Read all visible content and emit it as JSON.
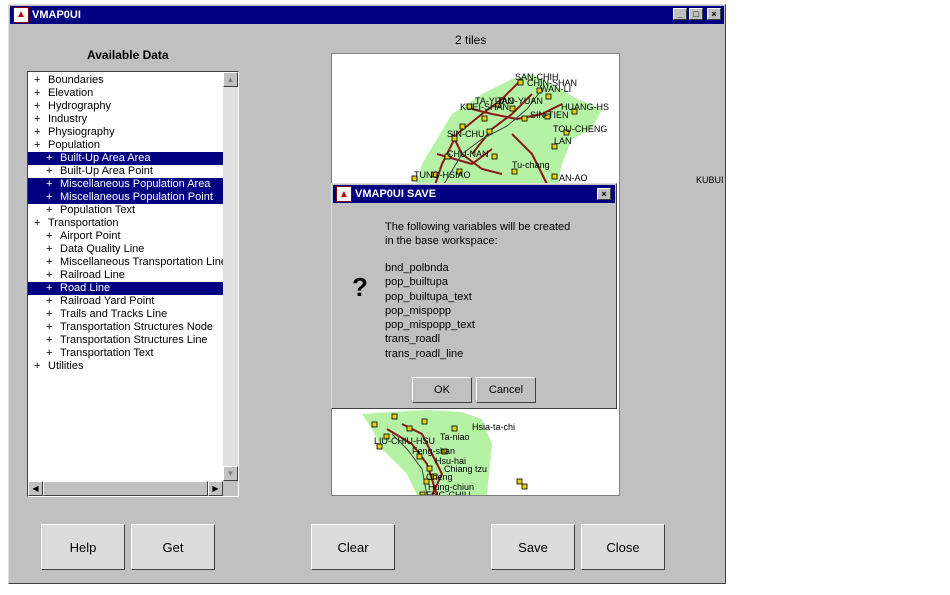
{
  "window": {
    "title": "VMAP0UI",
    "controls": {
      "minimize": "_",
      "maximize": "□",
      "close": "×"
    }
  },
  "available_data": {
    "title": "Available Data",
    "items": [
      {
        "label": "Boundaries",
        "level": 0,
        "selected": false
      },
      {
        "label": "Elevation",
        "level": 0,
        "selected": false
      },
      {
        "label": "Hydrography",
        "level": 0,
        "selected": false
      },
      {
        "label": "Industry",
        "level": 0,
        "selected": false
      },
      {
        "label": "Physiography",
        "level": 0,
        "selected": false
      },
      {
        "label": "Population",
        "level": 0,
        "selected": false
      },
      {
        "label": "Built-Up Area Area",
        "level": 1,
        "selected": true
      },
      {
        "label": "Built-Up Area Point",
        "level": 1,
        "selected": false
      },
      {
        "label": "Miscellaneous Population Area",
        "level": 1,
        "selected": true
      },
      {
        "label": "Miscellaneous Population Point",
        "level": 1,
        "selected": true
      },
      {
        "label": "Population Text",
        "level": 1,
        "selected": false
      },
      {
        "label": "Transportation",
        "level": 0,
        "selected": false
      },
      {
        "label": "Airport Point",
        "level": 1,
        "selected": false
      },
      {
        "label": "Data Quality Line",
        "level": 1,
        "selected": false
      },
      {
        "label": "Miscellaneous Transportation Line",
        "level": 1,
        "selected": false
      },
      {
        "label": "Railroad Line",
        "level": 1,
        "selected": false
      },
      {
        "label": "Road Line",
        "level": 1,
        "selected": true
      },
      {
        "label": "Railroad Yard Point",
        "level": 1,
        "selected": false
      },
      {
        "label": "Trails and Tracks Line",
        "level": 1,
        "selected": false
      },
      {
        "label": "Transportation Structures Node",
        "level": 1,
        "selected": false
      },
      {
        "label": "Transportation Structures Line",
        "level": 1,
        "selected": false
      },
      {
        "label": "Transportation Text",
        "level": 1,
        "selected": false
      },
      {
        "label": "Utilities",
        "level": 0,
        "selected": false
      }
    ],
    "expander": "+"
  },
  "map": {
    "tiles_label": "2 tiles",
    "outside_label": "KUBUI",
    "place_labels": [
      {
        "text": "SAN-CHIH"
      },
      {
        "text": "CHIN-SHAN"
      },
      {
        "text": "WAN-LI"
      },
      {
        "text": "TA-YUAN"
      },
      {
        "text": "TAO-YUAN"
      },
      {
        "text": "KUEI-SHAN"
      },
      {
        "text": "HUANG-HS"
      },
      {
        "text": "SIN-TIEN"
      },
      {
        "text": "TOU-CHENG"
      },
      {
        "text": "SIN-CHU"
      },
      {
        "text": "LAN"
      },
      {
        "text": "CHU-NAN"
      },
      {
        "text": "Tu-chang"
      },
      {
        "text": "TUNG-HSIAO"
      },
      {
        "text": "AN-AO"
      },
      {
        "text": "Hsia-ta-chi"
      },
      {
        "text": "Ta-niao"
      },
      {
        "text": "LIU-CHIU-HSU"
      },
      {
        "text": "Feng-shan"
      },
      {
        "text": "Hsu-hai"
      },
      {
        "text": "Chiang tzu"
      },
      {
        "text": "Cheng"
      },
      {
        "text": "Hung-chiun"
      },
      {
        "text": "ENG-CHIU"
      }
    ]
  },
  "dialog": {
    "title": "VMAP0UI SAVE",
    "icon": "?",
    "close": "×",
    "message_line1": "The following variables will be created",
    "message_line2": "in the base workspace:",
    "variables": [
      "bnd_polbnda",
      "pop_builtupa",
      "pop_builtupa_text",
      "pop_mispopp",
      "pop_mispopp_text",
      "trans_roadl",
      "trans_roadl_line"
    ],
    "ok_label": "OK",
    "cancel_label": "Cancel"
  },
  "buttons": {
    "help": "Help",
    "get": "Get",
    "clear": "Clear",
    "save": "Save",
    "close": "Close"
  },
  "colors": {
    "titlebar": "#000080",
    "selection": "#000080",
    "land": "#b5f2a6",
    "road": "#8b1a1a",
    "marker": "#e0d000"
  }
}
